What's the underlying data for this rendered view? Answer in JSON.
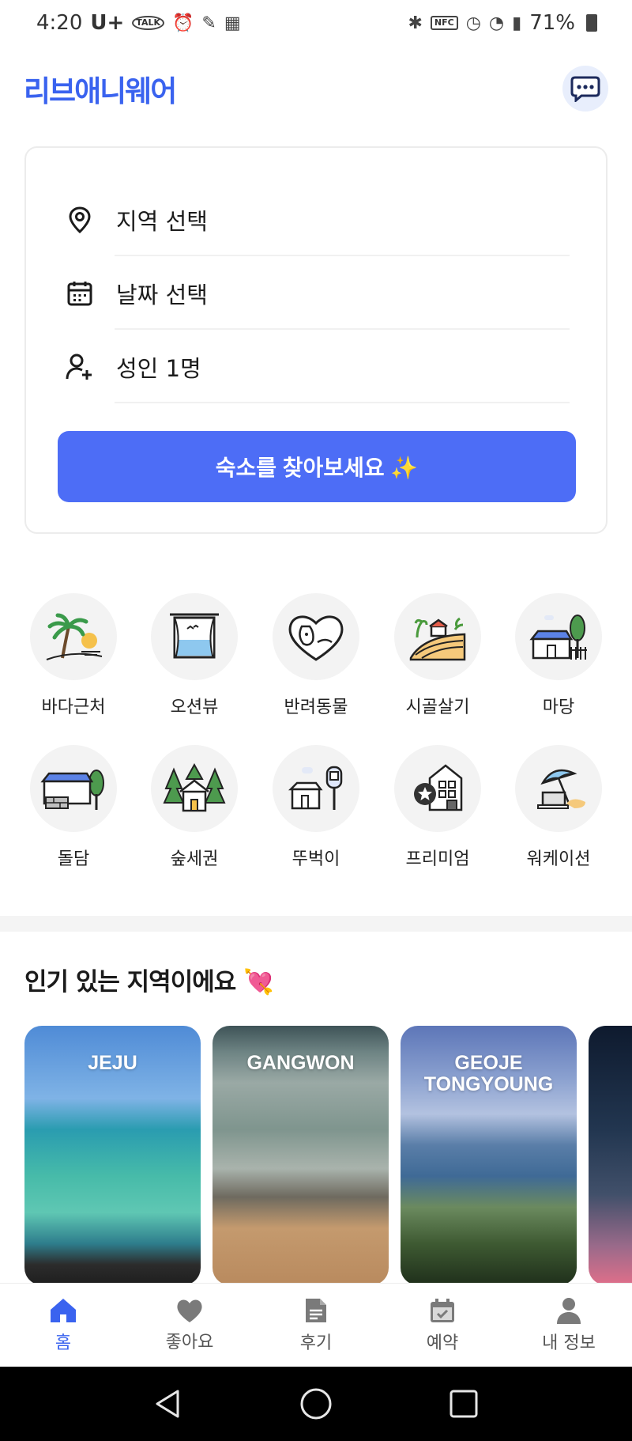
{
  "status_bar": {
    "time": "4:20",
    "carrier": "U+",
    "talk_badge": "TALK",
    "nfc_badge": "NFC",
    "battery": "71%"
  },
  "header": {
    "logo": "리브애니웨어"
  },
  "search": {
    "region_label": "지역 선택",
    "date_label": "날짜 선택",
    "guests_label": "성인 1명",
    "button_label": "숙소를 찾아보세요 ✨"
  },
  "categories": [
    {
      "label": "바다근처",
      "icon": "palm-beach-icon"
    },
    {
      "label": "오션뷰",
      "icon": "ocean-window-icon"
    },
    {
      "label": "반려동물",
      "icon": "pet-heart-icon"
    },
    {
      "label": "시골살기",
      "icon": "countryside-icon"
    },
    {
      "label": "마당",
      "icon": "yard-house-icon"
    },
    {
      "label": "돌담",
      "icon": "stone-wall-icon"
    },
    {
      "label": "숲세권",
      "icon": "forest-house-icon"
    },
    {
      "label": "뚜벅이",
      "icon": "bus-stop-icon"
    },
    {
      "label": "프리미엄",
      "icon": "premium-building-icon"
    },
    {
      "label": "워케이션",
      "icon": "workation-umbrella-icon"
    }
  ],
  "popular": {
    "title": "인기 있는 지역이에요 💘",
    "regions": [
      {
        "name": "JEJU"
      },
      {
        "name": "GANGWON"
      },
      {
        "name": "GEOJE TONGYOUNG"
      }
    ]
  },
  "bottom_nav": [
    {
      "label": "홈",
      "icon": "home-icon",
      "active": true
    },
    {
      "label": "좋아요",
      "icon": "heart-icon",
      "active": false
    },
    {
      "label": "후기",
      "icon": "document-icon",
      "active": false
    },
    {
      "label": "예약",
      "icon": "calendar-check-icon",
      "active": false
    },
    {
      "label": "내 정보",
      "icon": "person-icon",
      "active": false
    }
  ],
  "colors": {
    "brand": "#3a63ef",
    "button": "#4d6df6"
  }
}
